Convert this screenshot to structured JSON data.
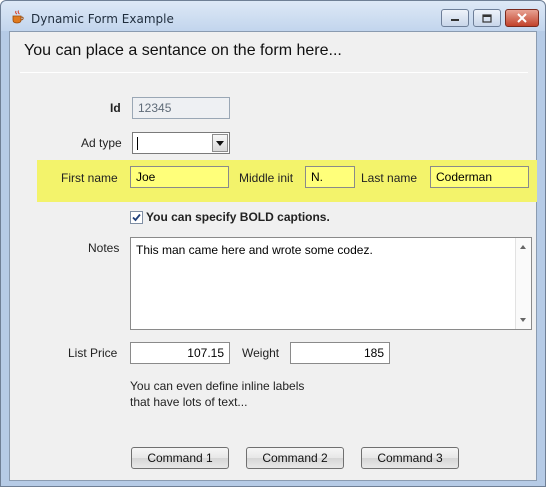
{
  "window": {
    "title": "Dynamic Form Example"
  },
  "form": {
    "heading": "You can place a sentance on the form here...",
    "id": {
      "label": "Id",
      "value": "12345"
    },
    "ad_type": {
      "label": "Ad type",
      "value": ""
    },
    "first_name": {
      "label": "First name",
      "value": "Joe"
    },
    "middle_init": {
      "label": "Middle init",
      "value": "N."
    },
    "last_name": {
      "label": "Last name",
      "value": "Coderman"
    },
    "bold_check": {
      "label": "You can specify BOLD captions.",
      "checked": true
    },
    "notes": {
      "label": "Notes",
      "value": "This man came here and wrote some codez."
    },
    "list_price": {
      "label": "List Price",
      "value": "107.15"
    },
    "weight": {
      "label": "Weight",
      "value": "185"
    },
    "inline_label": {
      "line1": "You can even define inline labels",
      "line2": "that have lots of text..."
    }
  },
  "buttons": {
    "command1": "Command 1",
    "command2": "Command 2",
    "command3": "Command 3"
  },
  "colors": {
    "highlight": "#f3f36b",
    "field_yellow": "#ffff7a",
    "close_button": "#c2422b"
  },
  "icons": {
    "app": "java-coffee-cup-icon",
    "minimize": "minimize-icon",
    "maximize": "maximize-icon",
    "close": "close-icon",
    "dropdown": "chevron-down-icon",
    "check": "checkmark-icon",
    "scroll_up": "scroll-up-arrow-icon",
    "scroll_down": "scroll-down-arrow-icon"
  }
}
